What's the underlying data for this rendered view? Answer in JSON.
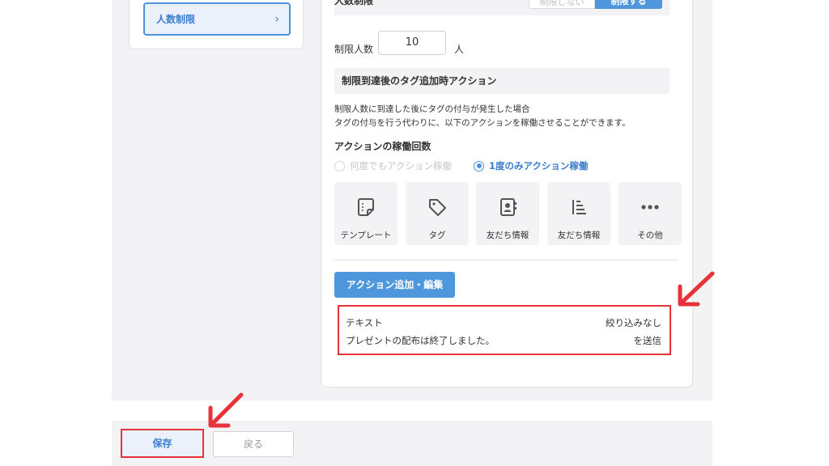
{
  "sidebar": {
    "active_item": "人数制限"
  },
  "top_setting": {
    "label": "人数制限",
    "option_off": "制限しない",
    "option_on": "制限する"
  },
  "limit": {
    "label": "制限人数",
    "value": "10",
    "unit": "人"
  },
  "after_limit": {
    "heading": "制限到達後のタグ追加時アクション",
    "desc_line1": "制限人数に到達した後にタグの付与が発生した場合",
    "desc_line2": "タグの付与を行う代わりに、以下のアクションを稼働させることができます。"
  },
  "action_count": {
    "heading": "アクションの稼働回数",
    "option_any": "何度でもアクション稼働",
    "option_once": "1度のみアクション稼働",
    "selected": "option_once"
  },
  "action_tiles": [
    {
      "label": "テンプレート",
      "icon": "template-icon"
    },
    {
      "label": "タグ",
      "icon": "tag-icon"
    },
    {
      "label": "友だち情報",
      "icon": "contact-card-icon"
    },
    {
      "label": "友だち情報",
      "icon": "list-icon"
    },
    {
      "label": "その他",
      "icon": "more-icon"
    }
  ],
  "add_button": "アクション追加・編集",
  "action_summary": {
    "type": "テキスト",
    "filter": "絞り込みなし",
    "message": "プレゼントの配布は終了しました。",
    "send": "を送信"
  },
  "footer": {
    "save": "保存",
    "back": "戻る"
  },
  "colors": {
    "accent": "#4f97dc",
    "highlight_red": "#e8323a",
    "panel_bg": "#f3f3f5"
  }
}
